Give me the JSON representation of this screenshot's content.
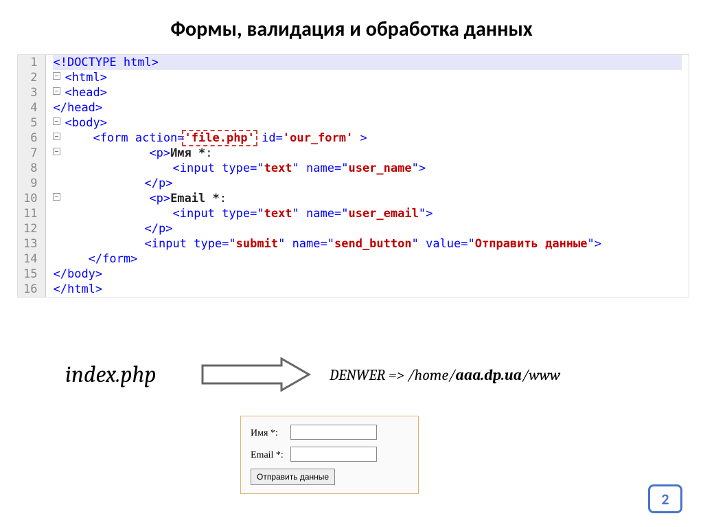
{
  "title": "Формы, валидация и обработка данных",
  "gutter": [
    "1",
    "2",
    "3",
    "4",
    "5",
    "6",
    "7",
    "8",
    "9",
    "10",
    "11",
    "12",
    "13",
    "14",
    "15",
    "16"
  ],
  "code": {
    "l1": "<!DOCTYPE html>",
    "l2a": "<",
    "l2b": "html",
    "l2c": ">",
    "l3a": "<",
    "l3b": "head",
    "l3c": ">",
    "l4a": "</",
    "l4b": "head",
    "l4c": ">",
    "l5a": "<",
    "l5b": "body",
    "l5c": ">",
    "l6a": "<",
    "l6b": "form ",
    "l6c": "action",
    "l6d": "=",
    "l6e": "'file.php'",
    "l6f": " id",
    "l6g": "=",
    "l6h": "'our_form'",
    "l6i": " >",
    "l7a": "<",
    "l7b": "p",
    "l7c": ">",
    "l7d": "Имя *",
    "l7e": ":",
    "l8a": "<",
    "l8b": "input ",
    "l8c": "type",
    "l8d": "=\"",
    "l8e": "text",
    "l8f": "\" ",
    "l8g": "name",
    "l8h": "=\"",
    "l8i": "user_name",
    "l8j": "\">",
    "l9a": "</",
    "l9b": "p",
    "l9c": ">",
    "l10a": "<",
    "l10b": "p",
    "l10c": ">",
    "l10d": "Email *",
    "l10e": ":",
    "l11a": "<",
    "l11b": "input ",
    "l11c": "type",
    "l11d": "=\"",
    "l11e": "text",
    "l11f": "\" ",
    "l11g": "name",
    "l11h": "=\"",
    "l11i": "user_email",
    "l11j": "\">",
    "l12a": "</",
    "l12b": "p",
    "l12c": ">",
    "l13a": "<",
    "l13b": "input ",
    "l13c": "type",
    "l13d": "=\"",
    "l13e": "submit",
    "l13f": "\" ",
    "l13g": "name",
    "l13h": "=\"",
    "l13i": "send_button",
    "l13j": "\" ",
    "l13k": "value",
    "l13l": "=\"",
    "l13m": "Отправить данные",
    "l13n": "\">",
    "l14a": "</",
    "l14b": "form",
    "l14c": ">",
    "l15a": "</",
    "l15b": "body",
    "l15c": ">",
    "l16a": "</",
    "l16b": "html",
    "l16c": ">"
  },
  "filename": "index.php",
  "path_prefix": "DENWER => /home/",
  "path_bold": "aaa.dp.ua",
  "path_suffix": "/www",
  "form": {
    "name_label": "Имя *:",
    "email_label": "Email *:",
    "button": "Отправить данные"
  },
  "page": "2"
}
